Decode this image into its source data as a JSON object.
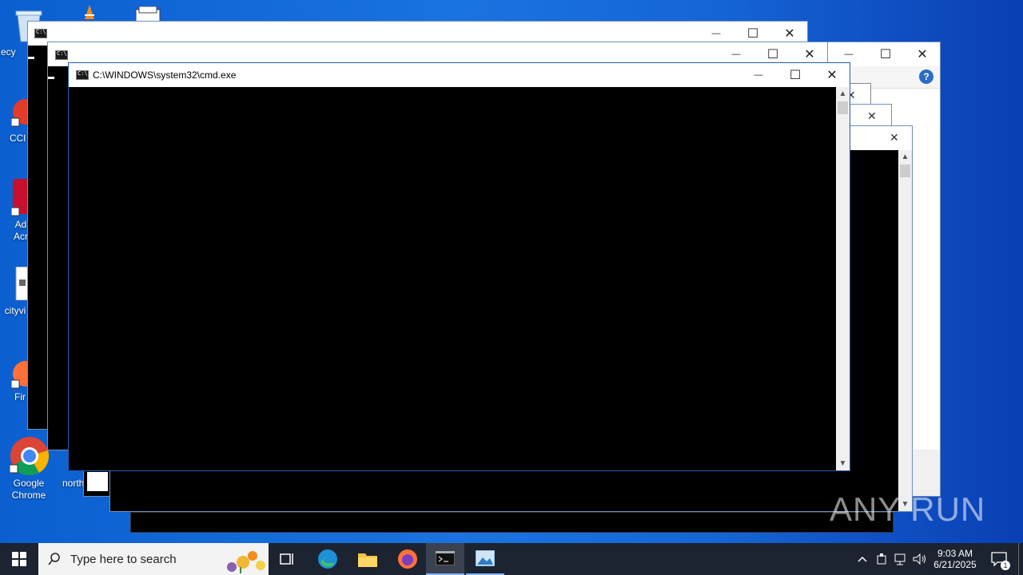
{
  "desktop": {
    "icons": [
      {
        "name": "recycle-bin",
        "label": "Recy"
      },
      {
        "name": "ccleaner",
        "label": "CCl"
      },
      {
        "name": "adobe-acrobat",
        "label": "Ad\nAcr"
      },
      {
        "name": "cityview",
        "label": "cityvi"
      },
      {
        "name": "firefox-shortcut",
        "label": "Fir"
      },
      {
        "name": "google-chrome",
        "label": "Google\nChrome"
      },
      {
        "name": "north-file",
        "label": "north"
      }
    ]
  },
  "windows": {
    "active_title": "C:\\WINDOWS\\system32\\cmd.exe",
    "controls": {
      "minimize": "—",
      "maximize": "☐",
      "close": "✕"
    },
    "help_glyph": "?"
  },
  "taskbar": {
    "search_placeholder": "Type here to search",
    "time": "9:03 AM",
    "date": "6/21/2025",
    "notification_count": "1",
    "icons": [
      "windows-start-icon",
      "search-icon",
      "task-view-icon",
      "edge-icon",
      "file-explorer-icon",
      "firefox-icon",
      "cmd-icon",
      "image-viewer-icon"
    ]
  },
  "watermark": {
    "text": "ANY RUN"
  },
  "colors": {
    "desktop": "#1a73e0",
    "taskbar": "#1c2331",
    "console": "#000000"
  }
}
